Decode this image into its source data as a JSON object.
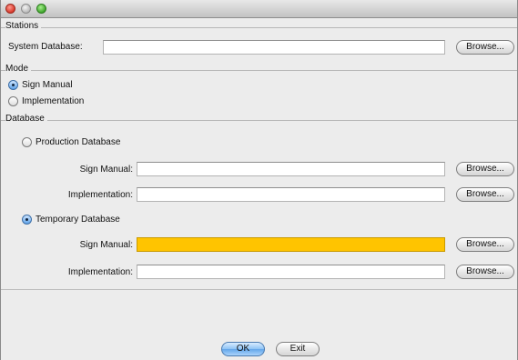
{
  "stations": {
    "title": "Stations",
    "system_db_label": "System Database:",
    "system_db_value": "",
    "browse_label": "Browse..."
  },
  "mode": {
    "title": "Mode",
    "options": [
      {
        "label": "Sign Manual",
        "selected": true
      },
      {
        "label": "Implementation",
        "selected": false
      }
    ]
  },
  "database": {
    "title": "Database",
    "production": {
      "label": "Production Database",
      "selected": false,
      "sign_manual_label": "Sign Manual:",
      "sign_manual_value": "",
      "implementation_label": "Implementation:",
      "implementation_value": "",
      "browse_label": "Browse..."
    },
    "temporary": {
      "label": "Temporary Database",
      "selected": true,
      "sign_manual_label": "Sign Manual:",
      "sign_manual_value": "",
      "sign_manual_highlight": "#ffc400",
      "implementation_label": "Implementation:",
      "implementation_value": "",
      "browse_label": "Browse..."
    }
  },
  "footer": {
    "ok_label": "OK",
    "exit_label": "Exit"
  }
}
